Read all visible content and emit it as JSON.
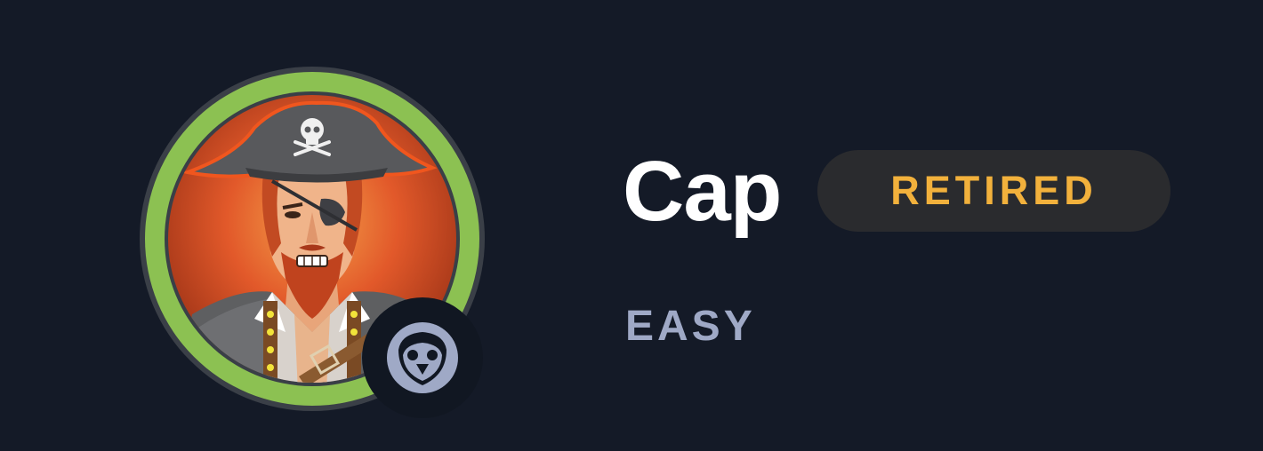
{
  "machine": {
    "name": "Cap",
    "status": "RETIRED",
    "difficulty": "EASY",
    "avatar_icon": "pirate-captain-avatar",
    "os_icon": "linux-penguin-icon"
  },
  "colors": {
    "background": "#141a27",
    "difficulty_ring": "#8cc152",
    "status_text": "#f2b13c",
    "status_pill": "#2a2b2e",
    "difficulty_text": "#9fa9c6"
  }
}
